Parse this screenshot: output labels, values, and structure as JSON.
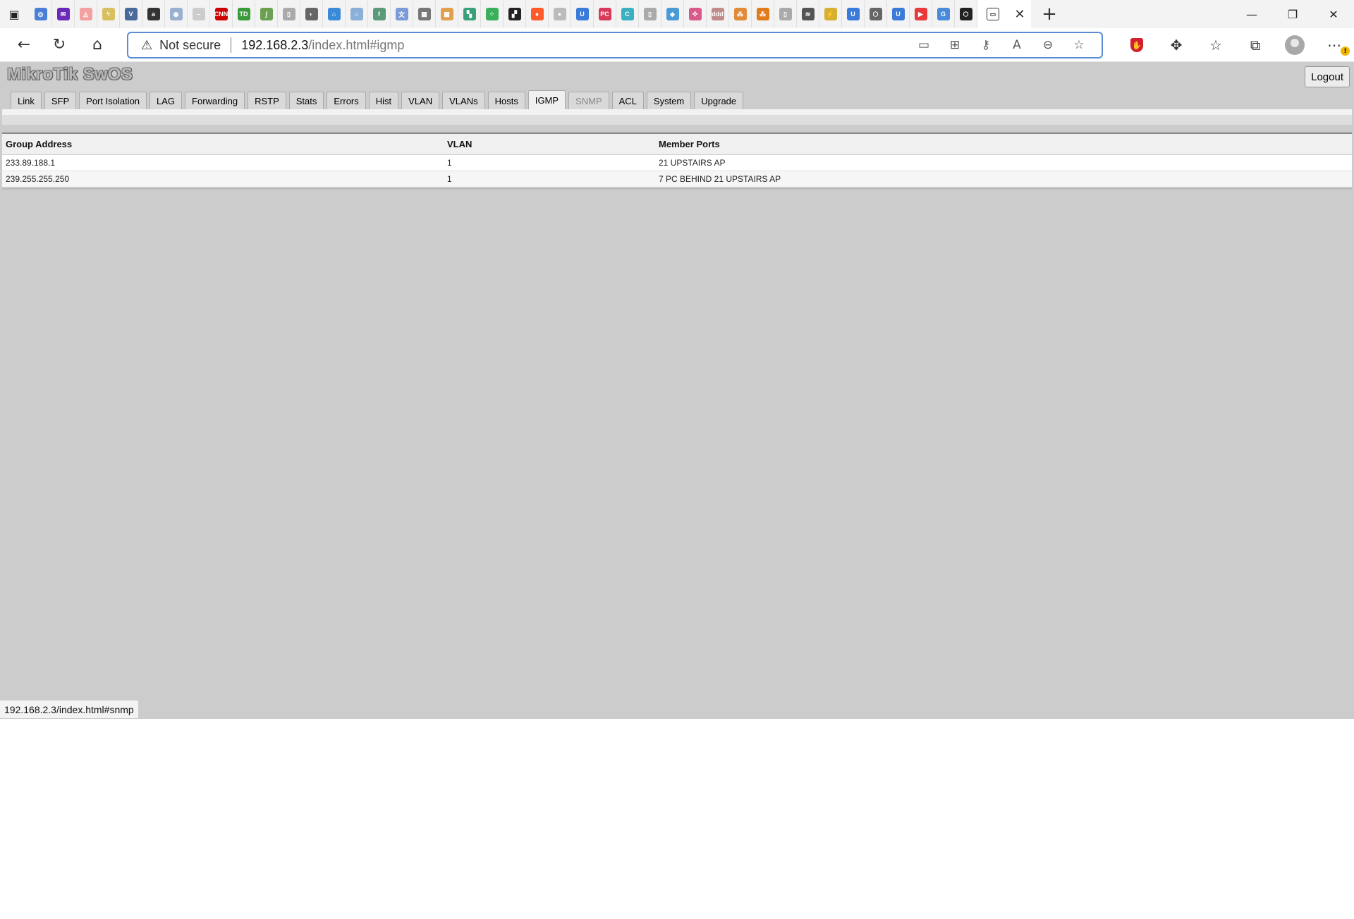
{
  "browser": {
    "pinned_tabs": [
      {
        "icon": "chrome-blue-icon",
        "glyph": "◎",
        "color": "#4a7fd8"
      },
      {
        "icon": "mail-icon",
        "glyph": "✉",
        "color": "#6a2ab8"
      },
      {
        "icon": "airbnb-icon",
        "glyph": "◬",
        "color": "#f2a0a0"
      },
      {
        "icon": "bolt-icon",
        "glyph": "ϟ",
        "color": "#d8c060"
      },
      {
        "icon": "v-icon",
        "glyph": "V",
        "color": "#4a6a9a"
      },
      {
        "icon": "amazon-icon",
        "glyph": "a",
        "color": "#333333"
      },
      {
        "icon": "circle-icon",
        "glyph": "◉",
        "color": "#9ab0d0"
      },
      {
        "icon": "dash-icon",
        "glyph": "–",
        "color": "#cccccc"
      },
      {
        "icon": "cnn-icon",
        "glyph": "CNN",
        "color": "#cc0000"
      },
      {
        "icon": "td-icon",
        "glyph": "TD",
        "color": "#3a9a3a"
      },
      {
        "icon": "leaf-icon",
        "glyph": "ʃ",
        "color": "#6aa050"
      },
      {
        "icon": "page-icon",
        "glyph": "▯",
        "color": "#aaaaaa"
      },
      {
        "icon": "shazam-icon",
        "glyph": "◐",
        "color": "#666666"
      },
      {
        "icon": "home-blue-icon",
        "glyph": "⌂",
        "color": "#3a8ad8"
      },
      {
        "icon": "home-light-icon",
        "glyph": "⌂",
        "color": "#8ab0d8"
      },
      {
        "icon": "green-f-icon",
        "glyph": "f",
        "color": "#5a9a7a"
      },
      {
        "icon": "translate-icon",
        "glyph": "文",
        "color": "#7a9ad8"
      },
      {
        "icon": "grid-icon",
        "glyph": "▦",
        "color": "#777777"
      },
      {
        "icon": "waffle-icon",
        "glyph": "▩",
        "color": "#e0a050"
      },
      {
        "icon": "tiles-icon",
        "glyph": "▚",
        "color": "#3aa07a"
      },
      {
        "icon": "dots-green-icon",
        "glyph": "⁘",
        "color": "#3ab05a"
      },
      {
        "icon": "color-squares-icon",
        "glyph": "▞",
        "color": "#222222"
      },
      {
        "icon": "reddit-icon",
        "glyph": "●",
        "color": "#ff5a2a"
      },
      {
        "icon": "apple-icon",
        "glyph": "●",
        "color": "#bbbbbb"
      },
      {
        "icon": "u-blue-icon",
        "glyph": "U",
        "color": "#3a7ad8"
      },
      {
        "icon": "pc-icon",
        "glyph": "PC",
        "color": "#d83a5a"
      },
      {
        "icon": "c-icon",
        "glyph": "C",
        "color": "#3ab0c0"
      },
      {
        "icon": "page2-icon",
        "glyph": "▯",
        "color": "#aaaaaa"
      },
      {
        "icon": "map-icon",
        "glyph": "◈",
        "color": "#4a9ad8"
      },
      {
        "icon": "pinwheel-icon",
        "glyph": "✣",
        "color": "#d85a8a"
      },
      {
        "icon": "ddd-icon",
        "glyph": "ddd",
        "color": "#c08a8a"
      },
      {
        "icon": "orange-network-icon",
        "glyph": "⁂",
        "color": "#e08a3a"
      },
      {
        "icon": "orange-tree-icon",
        "glyph": "⁂",
        "color": "#e07a1a"
      },
      {
        "icon": "page3-icon",
        "glyph": "▯",
        "color": "#aaaaaa"
      },
      {
        "icon": "wifi-icon",
        "glyph": "≋",
        "color": "#555555"
      },
      {
        "icon": "yellow-icon",
        "glyph": "⚡",
        "color": "#d8b030"
      },
      {
        "icon": "u-blue2-icon",
        "glyph": "U",
        "color": "#3a7ad8"
      },
      {
        "icon": "cube-icon",
        "glyph": "⬡",
        "color": "#666666"
      },
      {
        "icon": "u-blue3-icon",
        "glyph": "U",
        "color": "#3a7ad8"
      },
      {
        "icon": "youtube-icon",
        "glyph": "▶",
        "color": "#e83a3a"
      },
      {
        "icon": "google-icon",
        "glyph": "G",
        "color": "#4a8ad8"
      },
      {
        "icon": "mikrotik-icon",
        "glyph": "⬡",
        "color": "#222222"
      }
    ],
    "address": {
      "warning": "Not secure",
      "host": "192.168.2.3",
      "path": "/index.html#igmp"
    },
    "status_url": "192.168.2.3/index.html#snmp"
  },
  "app": {
    "brand": "MikroTik SwOS",
    "logout_label": "Logout",
    "tabs": [
      {
        "label": "Link",
        "state": "normal"
      },
      {
        "label": "SFP",
        "state": "normal"
      },
      {
        "label": "Port Isolation",
        "state": "normal"
      },
      {
        "label": "LAG",
        "state": "normal"
      },
      {
        "label": "Forwarding",
        "state": "normal"
      },
      {
        "label": "RSTP",
        "state": "normal"
      },
      {
        "label": "Stats",
        "state": "normal"
      },
      {
        "label": "Errors",
        "state": "normal"
      },
      {
        "label": "Hist",
        "state": "normal"
      },
      {
        "label": "VLAN",
        "state": "normal"
      },
      {
        "label": "VLANs",
        "state": "normal"
      },
      {
        "label": "Hosts",
        "state": "normal"
      },
      {
        "label": "IGMP",
        "state": "active"
      },
      {
        "label": "SNMP",
        "state": "disabled"
      },
      {
        "label": "ACL",
        "state": "normal"
      },
      {
        "label": "System",
        "state": "normal"
      },
      {
        "label": "Upgrade",
        "state": "normal"
      }
    ],
    "igmp_table": {
      "columns": [
        "Group Address",
        "VLAN",
        "Member Ports"
      ],
      "rows": [
        [
          "233.89.188.1",
          "1",
          "21 UPSTAIRS AP"
        ],
        [
          "239.255.255.250",
          "1",
          "7 PC BEHIND 21 UPSTAIRS AP"
        ]
      ]
    }
  }
}
